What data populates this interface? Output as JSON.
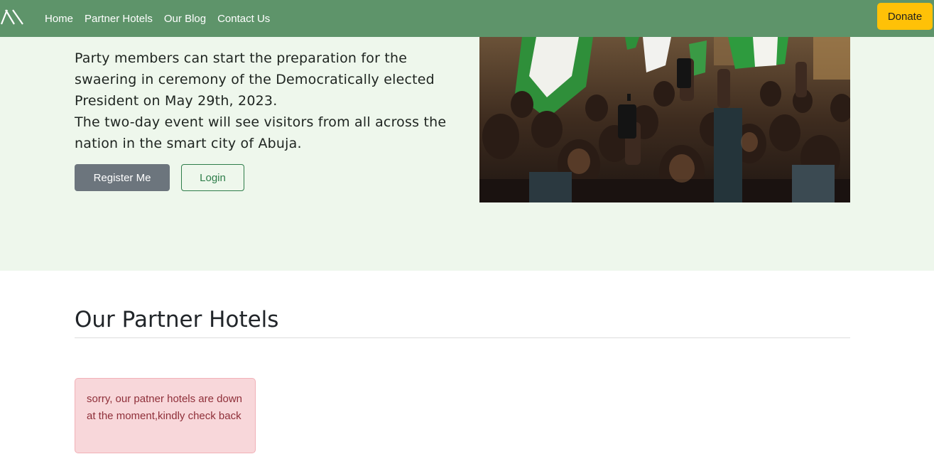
{
  "nav": {
    "links": [
      "Home",
      "Partner Hotels",
      "Our Blog",
      "Contact Us"
    ],
    "donate_label": "Donate",
    "brand_icon": "logo-slashes-icon"
  },
  "hero": {
    "lines": [
      "Party members can start the preparation for the",
      "swaering in ceremony of the Democratically elected",
      "President on May 29th, 2023.",
      "The two-day event will see visitors from all across the",
      "nation in the smart city of Abuja."
    ],
    "register_label": "Register Me",
    "login_label": "Login"
  },
  "hotels": {
    "title": "Our Partner Hotels",
    "alert_text": "sorry, our patner hotels are down at the moment,kindly check back"
  },
  "colors": {
    "navbar": "#5e946a",
    "donate": "#ffc107",
    "hero_bg": "#eef7ec",
    "register": "#6c757d",
    "login": "#2e7d4a",
    "alert_bg": "#f8d7da",
    "alert_text": "#8f2f39"
  }
}
